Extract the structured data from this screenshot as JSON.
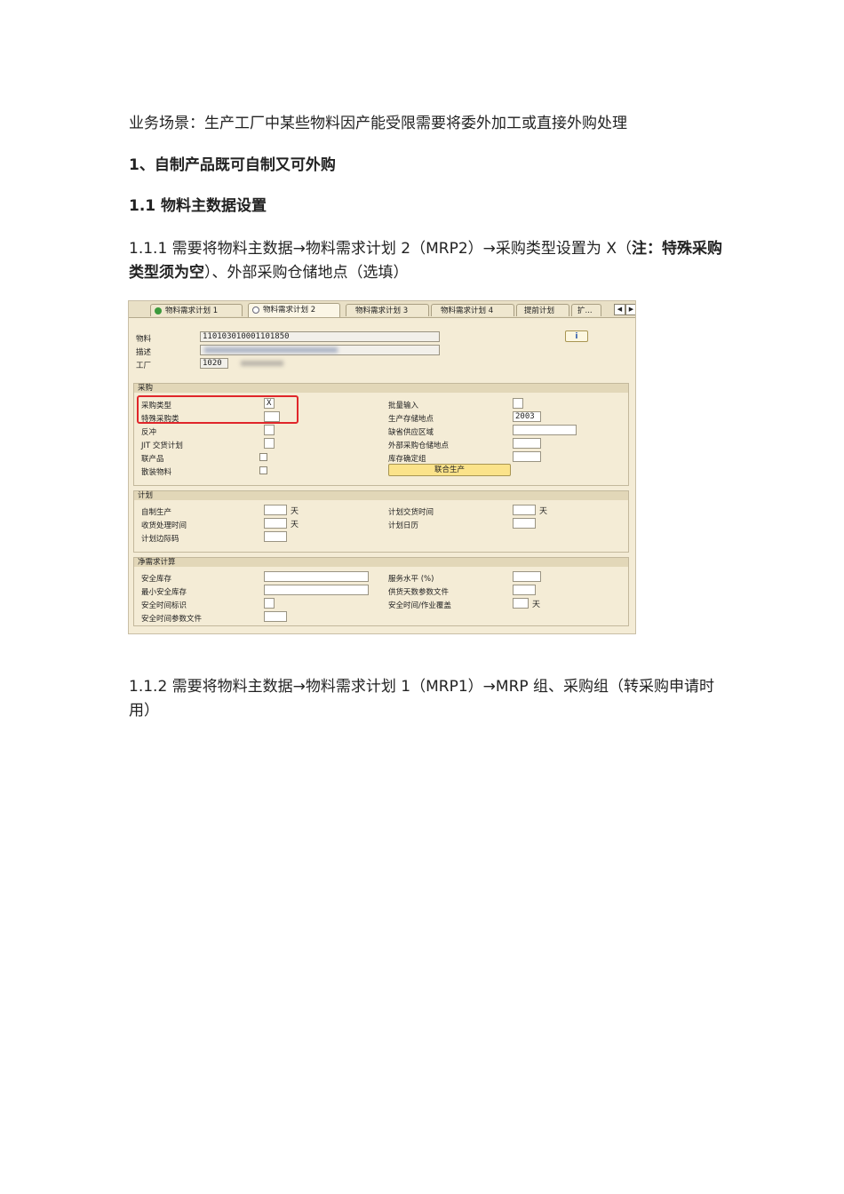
{
  "paragraphs": {
    "scene": "业务场景：生产工厂中某些物料因产能受限需要将委外加工或直接外购处理",
    "h1": "1、自制产品既可自制又可外购",
    "h2": "1.1 物料主数据设置",
    "p111_part1": "1.1.1 需要将物料主数据→物料需求计划 2（MRP2）→采购类型设置为 X（",
    "p111_bold": "注：特殊采购类型须为空",
    "p111_part2": "）、外部采购仓储地点（选填）",
    "p112": "1.1.2 需要将物料主数据→物料需求计划 1（MRP1）→MRP 组、采购组（转采购申请时用）"
  },
  "sap": {
    "tabs": [
      "物料需求计划 1",
      "物料需求计划 2",
      "物料需求计划 3",
      "物料需求计划 4",
      "提前计划",
      "扩..."
    ],
    "active_tab_index": 1,
    "header": {
      "material_label": "物料",
      "material_value": "110103010001101850",
      "desc_label": "描述",
      "plant_label": "工厂",
      "plant_value": "1020",
      "info_icon": "i"
    },
    "procurement": {
      "title": "采购",
      "procurement_type_label": "采购类型",
      "procurement_type_value": "X",
      "special_procurement_label": "特殊采购类",
      "backflush_label": "反冲",
      "jit_label": "JIT 交货计划",
      "coproduct_label": "联产品",
      "bulk_label": "散装物料",
      "batch_entry_label": "批量输入",
      "prod_storage_label": "生产存储地点",
      "prod_storage_value": "2003",
      "default_supply_area_label": "缺省供应区域",
      "ext_storage_label": "外部采购仓储地点",
      "stock_det_group_label": "库存确定组",
      "joint_production_button": "联合生产"
    },
    "scheduling": {
      "title": "计划",
      "inhouse_label": "自制生产",
      "inhouse_unit": "天",
      "gr_time_label": "收货处理时间",
      "gr_time_unit": "天",
      "margin_key_label": "计划边际码",
      "planned_delivery_label": "计划交货时间",
      "planned_delivery_unit": "天",
      "calendar_label": "计划日历"
    },
    "net_req": {
      "title": "净需求计算",
      "safety_stock_label": "安全库存",
      "min_safety_label": "最小安全库存",
      "safety_time_ind_label": "安全时间标识",
      "safety_time_profile_label": "安全时间参数文件",
      "service_level_label": "服务水平 (%)",
      "coverage_profile_label": "供货天数参数文件",
      "safety_time_label": "安全时间/作业覆盖",
      "safety_time_unit": "天"
    }
  }
}
